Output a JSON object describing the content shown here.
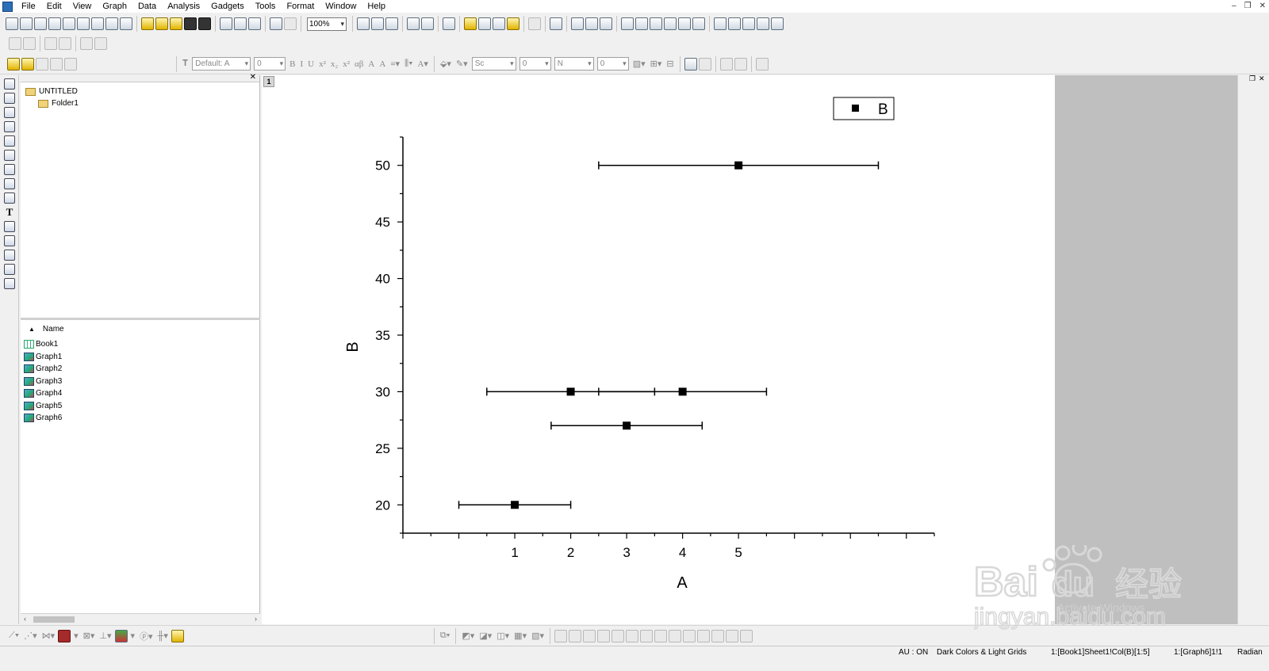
{
  "menu": [
    "File",
    "Edit",
    "View",
    "Graph",
    "Data",
    "Analysis",
    "Gadgets",
    "Tools",
    "Format",
    "Window",
    "Help"
  ],
  "toolbar": {
    "zoom": "100%",
    "font": "Default: A",
    "font_size": "0",
    "line_style": "Sc",
    "line_width": "0",
    "fill_label": "N",
    "fill_size": "0"
  },
  "format_glyphs": [
    "B",
    "I",
    "U",
    "x²",
    "x₂",
    "x²",
    "αβ",
    "A",
    "A"
  ],
  "explorer": {
    "root": "UNTITLED",
    "folder": "Folder1",
    "name_header": "Name",
    "items": [
      {
        "label": "Book1",
        "type": "book"
      },
      {
        "label": "Graph1",
        "type": "graph"
      },
      {
        "label": "Graph2",
        "type": "graph"
      },
      {
        "label": "Graph3",
        "type": "graph"
      },
      {
        "label": "Graph4",
        "type": "graph"
      },
      {
        "label": "Graph5",
        "type": "graph"
      },
      {
        "label": "Graph6",
        "type": "graph"
      }
    ]
  },
  "layer_tab": "1",
  "chart_data": {
    "type": "scatter",
    "xlabel": "A",
    "ylabel": "B",
    "xlim": [
      -1.0,
      8.5
    ],
    "ylim": [
      17.5,
      52.5
    ],
    "xticks": [
      1,
      2,
      3,
      4,
      5
    ],
    "yticks": [
      20,
      25,
      30,
      35,
      40,
      45,
      50
    ],
    "series": [
      {
        "name": "B",
        "points": [
          {
            "x": 1,
            "y": 20,
            "xerr": 1.0
          },
          {
            "x": 2,
            "y": 30,
            "xerr": 1.5
          },
          {
            "x": 3,
            "y": 27,
            "xerr": 1.35
          },
          {
            "x": 4,
            "y": 30,
            "xerr": 1.5
          },
          {
            "x": 5,
            "y": 50,
            "xerr": 2.5
          }
        ]
      }
    ],
    "legend": "top-right"
  },
  "status": {
    "au": "AU : ON",
    "theme": "Dark Colors & Light Grids",
    "cell": "1:[Book1]Sheet1!Col(B)[1:5]",
    "graph": "1:[Graph6]1!1",
    "unit": "Radian"
  },
  "watermark": {
    "brand": "Bai",
    "brand2": "du",
    "cn": "经验",
    "site": "jingyan.baidu.com",
    "activate": "Activate Windows"
  }
}
